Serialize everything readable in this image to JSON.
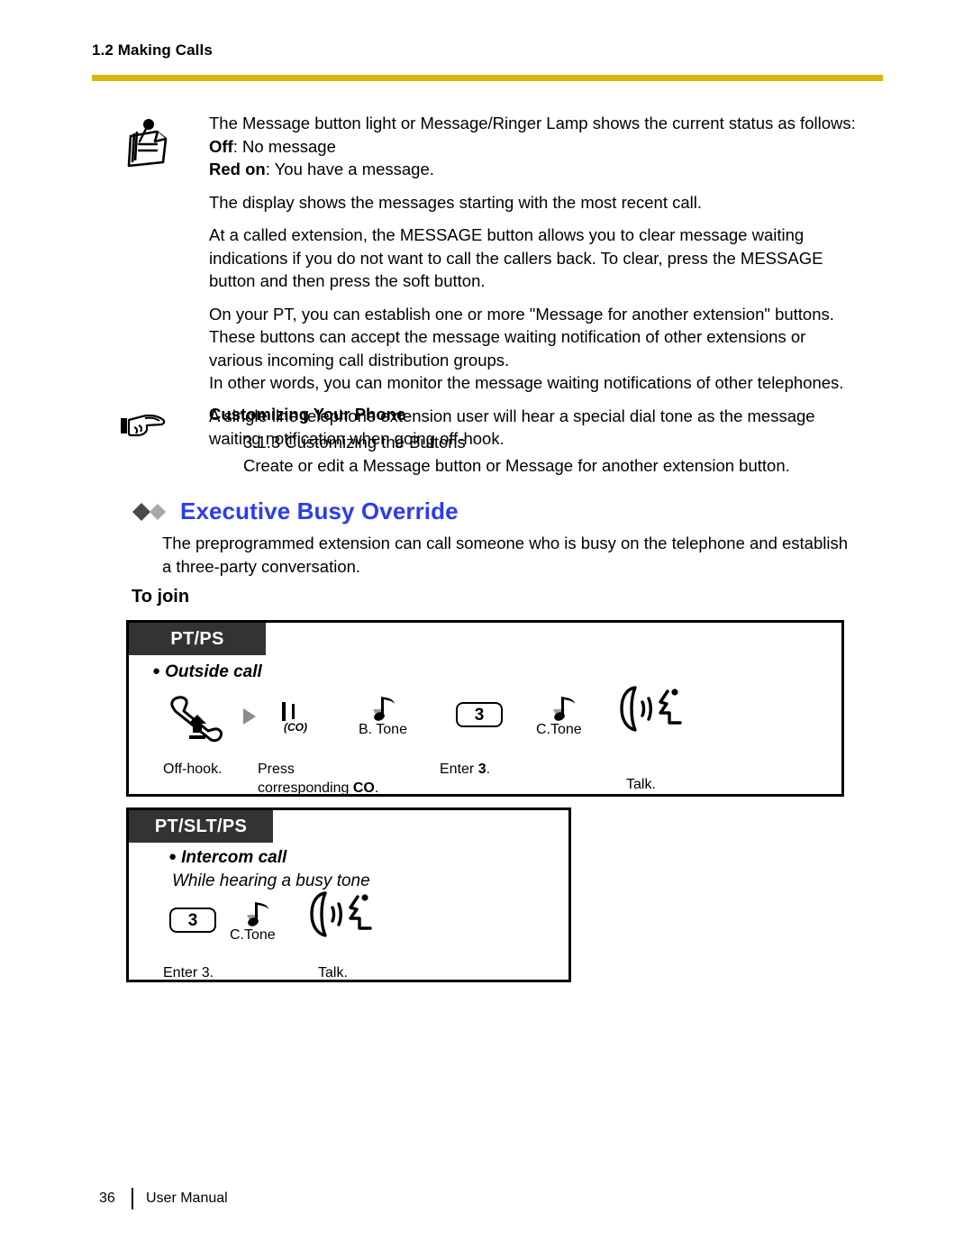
{
  "header": {
    "section": "1.2 Making Calls",
    "rule_color": "#d8b70a"
  },
  "note": {
    "icon": "note-pushpin-icon",
    "lines": {
      "l1": "The Message button light or Message/Ringer Lamp shows the current status as follows:",
      "off_label": "Off",
      "off_text": ": No message",
      "red_label": "Red on",
      "red_text": ": You have a message.",
      "l2": "The display shows the messages starting with the most recent call.",
      "l3": "At a called extension, the MESSAGE button allows you to clear message waiting indications if you do not want to call the callers back. To clear, press the MESSAGE button and then press the soft button.",
      "l4": "On your PT, you can establish one or more \"Message for another extension\" buttons. These buttons can accept the message waiting notification of other extensions or various incoming call distribution groups.",
      "l5": "In other words, you can monitor the message waiting notifications of other telephones.",
      "l6": "A single line telephone extension user will hear a special dial tone as the message waiting notification when going off-hook."
    }
  },
  "customizing": {
    "icon": "pointing-hand-icon",
    "title": "Customizing Your Phone",
    "reference": "3.1.3 Customizing the Buttons",
    "description": "Create or edit a Message button or Message for another extension button."
  },
  "feature": {
    "title": "Executive Busy Override",
    "title_color": "#2b3cf0",
    "diamond_dark": "#4a4a4a",
    "diamond_light": "#a8a8a8",
    "description": "The preprogrammed extension can call someone who is busy on the telephone and establish a three-party conversation.",
    "subheading": "To join"
  },
  "flows": [
    {
      "tag": "PT/PS",
      "call_type": "Outside call",
      "sub_note": "",
      "steps": [
        {
          "icon": "offhook-handset-icon",
          "label": "",
          "caption": "Off-hook.",
          "caption2": ""
        },
        {
          "icon": "arrow-right-icon",
          "label": "",
          "caption": "",
          "caption2": ""
        },
        {
          "icon": "co-line-key-icon",
          "label": "(CO)",
          "caption": "Press",
          "caption2": "corresponding CO."
        },
        {
          "icon": "tone-note-icon",
          "label": "B. Tone",
          "caption": "",
          "caption2": ""
        },
        {
          "icon": "keypad-key-icon",
          "label": "3",
          "caption": "Enter 3.",
          "caption2": ""
        },
        {
          "icon": "tone-note-icon",
          "label": "C.Tone",
          "caption": "",
          "caption2": ""
        },
        {
          "icon": "talk-handset-icon",
          "label": "",
          "caption": "Talk.",
          "caption2": ""
        }
      ]
    },
    {
      "tag": "PT/SLT/PS",
      "call_type": "Intercom call",
      "sub_note": "While hearing a busy tone",
      "steps": [
        {
          "icon": "keypad-key-icon",
          "label": "3",
          "caption": "Enter 3.",
          "caption2": ""
        },
        {
          "icon": "tone-note-icon",
          "label": "C.Tone",
          "caption": "",
          "caption2": ""
        },
        {
          "icon": "talk-handset-icon",
          "label": "",
          "caption": "Talk.",
          "caption2": ""
        }
      ]
    }
  ],
  "captions": {
    "offhook": "Off-hook.",
    "press": "Press",
    "press2_pre": "corresponding ",
    "press2_bold": "CO",
    "press2_post": ".",
    "enter3_pre": "Enter ",
    "enter3_bold": "3",
    "enter3_post": ".",
    "enter3_plain": "Enter 3.",
    "talk": "Talk.",
    "b_tone": "B. Tone",
    "c_tone": "C.Tone",
    "co_label": "(CO)",
    "key3": "3"
  },
  "footer": {
    "page": "36",
    "label": "User Manual"
  }
}
